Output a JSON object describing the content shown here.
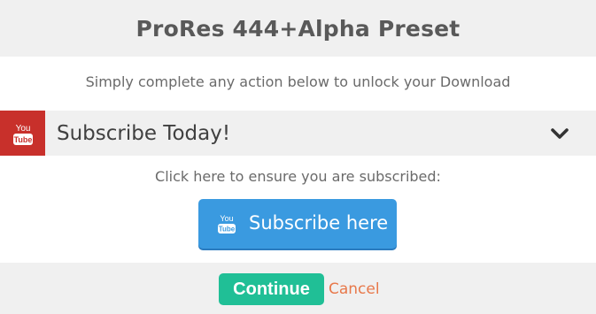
{
  "dialog": {
    "title": "ProRes 444+Alpha Preset",
    "instruction": "Simply complete any action below to unlock your Download"
  },
  "action": {
    "label": "Subscribe Today!",
    "icon": "youtube-icon",
    "icon_text_top": "You",
    "icon_text_bottom": "Tube",
    "expand_icon": "chevron-down-icon",
    "hint": "Click here to ensure you are subscribed:",
    "button_label": "Subscribe here",
    "button_icon_text_top": "You",
    "button_icon_text_bottom": "Tube"
  },
  "footer": {
    "continue_label": "Continue",
    "cancel_label": "Cancel"
  },
  "colors": {
    "youtube_red": "#c8302b",
    "button_blue": "#3a9ae0",
    "continue_green": "#20bf96",
    "cancel_orange": "#e8784a",
    "panel_gray": "#f0f0f0"
  }
}
